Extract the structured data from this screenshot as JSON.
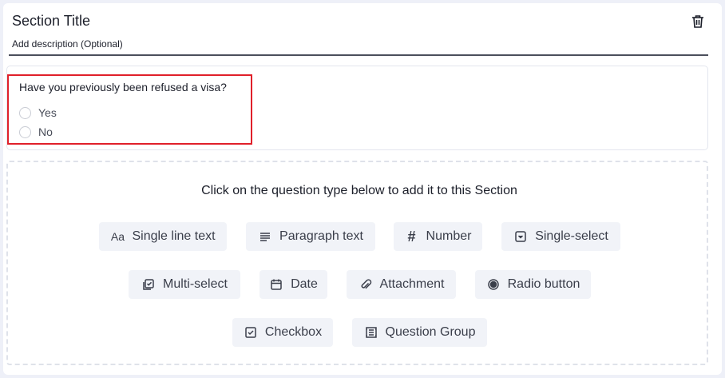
{
  "section": {
    "title": "Section Title",
    "description_placeholder": "Add description (Optional)"
  },
  "question": {
    "text": "Have you previously been refused a visa?",
    "options": [
      "Yes",
      "No"
    ]
  },
  "question_types": {
    "prompt": "Click on the question type below to add it to this Section",
    "items": [
      {
        "label": "Single line text",
        "icon": "text-aa-icon"
      },
      {
        "label": "Paragraph text",
        "icon": "paragraph-icon"
      },
      {
        "label": "Number",
        "icon": "hash-icon"
      },
      {
        "label": "Single-select",
        "icon": "dropdown-icon"
      },
      {
        "label": "Multi-select",
        "icon": "multi-select-icon"
      },
      {
        "label": "Date",
        "icon": "calendar-icon"
      },
      {
        "label": "Attachment",
        "icon": "paperclip-icon"
      },
      {
        "label": "Radio button",
        "icon": "radio-icon"
      },
      {
        "label": "Checkbox",
        "icon": "checkbox-icon"
      },
      {
        "label": "Question Group",
        "icon": "group-icon"
      }
    ]
  },
  "colors": {
    "highlight": "#e0202a",
    "button_bg": "#f1f3f8",
    "page_bg": "#eef0f8"
  }
}
